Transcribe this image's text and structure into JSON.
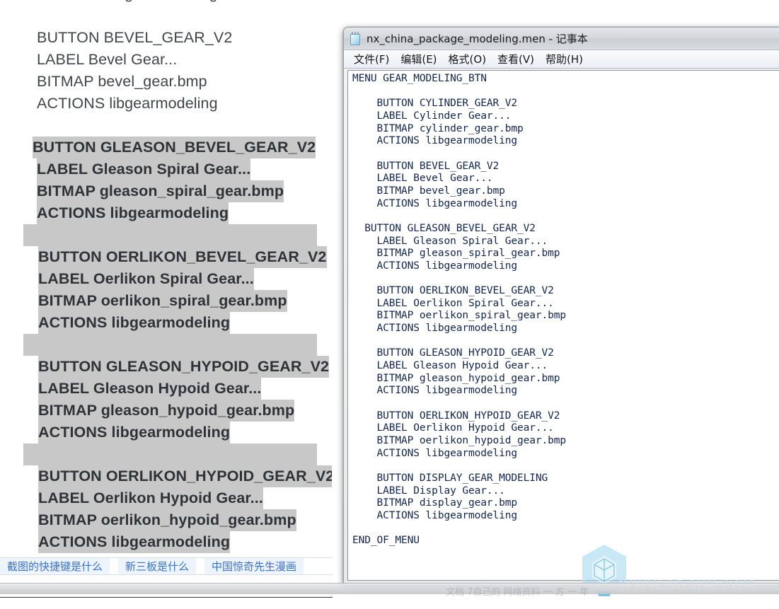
{
  "window": {
    "title": "nx_china_package_modeling.men - 记事本",
    "icon": "notepad-icon",
    "menu": [
      "文件(F)",
      "编辑(E)",
      "格式(O)",
      "查看(V)",
      "帮助(H)"
    ],
    "content": "MENU GEAR_MODELING_BTN\n\n    BUTTON CYLINDER_GEAR_V2\n    LABEL Cylinder Gear...\n    BITMAP cylinder_gear.bmp\n    ACTIONS libgearmodeling\n\n    BUTTON BEVEL_GEAR_V2\n    LABEL Bevel Gear...\n    BITMAP bevel_gear.bmp\n    ACTIONS libgearmodeling\n\n  BUTTON GLEASON_BEVEL_GEAR_V2\n    LABEL Gleason Spiral Gear...\n    BITMAP gleason_spiral_gear.bmp\n    ACTIONS libgearmodeling\n\n    BUTTON OERLIKON_BEVEL_GEAR_V2\n    LABEL Oerlikon Spiral Gear...\n    BITMAP oerlikon_spiral_gear.bmp\n    ACTIONS libgearmodeling\n\n    BUTTON GLEASON_HYPOID_GEAR_V2\n    LABEL Gleason Hypoid Gear...\n    BITMAP gleason_hypoid_gear.bmp\n    ACTIONS libgearmodeling\n\n    BUTTON OERLIKON_HYPOID_GEAR_V2\n    LABEL Oerlikon Hypoid Gear...\n    BITMAP oerlikon_hypoid_gear.bmp\n    ACTIONS libgearmodeling\n\n    BUTTON DISPLAY_GEAR_MODELING\n    LABEL Display Gear...\n    BITMAP display_gear.bmp\n    ACTIONS libgearmodeling\n\nEND_OF_MENU"
  },
  "left_document": {
    "lines": [
      {
        "text": "ACTIONS libgearmodeling",
        "selected": false,
        "indent": 52
      },
      {
        "text": "",
        "selected": false,
        "indent": 52
      },
      {
        "text": "BUTTON BEVEL_GEAR_V2",
        "selected": false,
        "indent": 52
      },
      {
        "text": "LABEL Bevel Gear...",
        "selected": false,
        "indent": 52
      },
      {
        "text": "BITMAP bevel_gear.bmp",
        "selected": false,
        "indent": 52
      },
      {
        "text": "ACTIONS libgearmodeling",
        "selected": false,
        "indent": 52
      },
      {
        "text": "",
        "selected": false,
        "indent": 52
      },
      {
        "text": "BUTTON GLEASON_BEVEL_GEAR_V2",
        "selected": true,
        "indent": 46
      },
      {
        "text": "LABEL Gleason Spiral Gear...",
        "selected": true,
        "indent": 52
      },
      {
        "text": "BITMAP gleason_spiral_gear.bmp",
        "selected": true,
        "indent": 52
      },
      {
        "text": "ACTIONS libgearmodeling",
        "selected": true,
        "indent": 52
      },
      {
        "text": "",
        "selected": true,
        "blankwidth": 415,
        "indent": 33
      },
      {
        "text": "BUTTON OERLIKON_BEVEL_GEAR_V2",
        "selected": true,
        "indent": 54
      },
      {
        "text": "LABEL Oerlikon Spiral Gear...",
        "selected": true,
        "indent": 54
      },
      {
        "text": "BITMAP oerlikon_spiral_gear.bmp",
        "selected": true,
        "indent": 54
      },
      {
        "text": "ACTIONS libgearmodeling",
        "selected": true,
        "indent": 54
      },
      {
        "text": "",
        "selected": true,
        "blankwidth": 415,
        "indent": 33
      },
      {
        "text": "BUTTON GLEASON_HYPOID_GEAR_V2",
        "selected": true,
        "indent": 54
      },
      {
        "text": "LABEL Gleason Hypoid Gear...",
        "selected": true,
        "indent": 54
      },
      {
        "text": "BITMAP gleason_hypoid_gear.bmp",
        "selected": true,
        "indent": 54
      },
      {
        "text": "ACTIONS libgearmodeling",
        "selected": true,
        "indent": 54
      },
      {
        "text": "",
        "selected": true,
        "blankwidth": 415,
        "indent": 33
      },
      {
        "text": "BUTTON OERLIKON_HYPOID_GEAR_V2",
        "selected": true,
        "indent": 54
      },
      {
        "text": "LABEL Oerlikon Hypoid Gear...",
        "selected": true,
        "indent": 54
      },
      {
        "text": "BITMAP oerlikon_hypoid_gear.bmp",
        "selected": true,
        "indent": 54
      },
      {
        "text": "ACTIONS libgearmodeling",
        "selected": true,
        "indent": 54
      }
    ]
  },
  "link_bar": {
    "links": [
      "截图的快捷键是什么",
      "新三板是什么",
      "中国惊奇先生漫画"
    ]
  },
  "watermark": {
    "text": "WWW.3DSJW.COM",
    "logo": "cube-hexagon-logo",
    "color": "#9fd4ea"
  },
  "taskbar": {
    "ghost_text": "文档    7自己的    网络资料        一 方 一 年"
  },
  "colors": {
    "selection_gray": "#c8c8c8",
    "doc_text": "#40454a",
    "notepad_text": "#12264f",
    "link_blue": "#3a71cf",
    "link_chip_bg": "#eef4fb"
  }
}
